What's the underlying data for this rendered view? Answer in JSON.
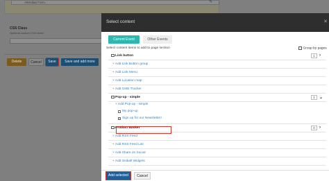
{
  "background": {
    "top_field_value": "Attendaa Form",
    "css_class_label": "CSS Class",
    "css_class_help": "Optional custom CSS class",
    "buttons": {
      "delete": "Delete",
      "cancel": "Cancel",
      "save": "Save",
      "save_and_add_more": "Save and add more"
    }
  },
  "modal": {
    "title": "Select content",
    "tabs": [
      {
        "label": "Current Event",
        "active": true
      },
      {
        "label": "Other Events",
        "active": false
      }
    ],
    "hint": "Select content items to add to page section",
    "group_by_label": "Group by pages",
    "items": [
      {
        "type": "header",
        "label": "Link button"
      },
      {
        "type": "item",
        "label": "+ Add Link Button group"
      },
      {
        "type": "item",
        "label": "+ Add Link Menu"
      },
      {
        "type": "item",
        "label": "+ Add Location map"
      },
      {
        "type": "item",
        "label": "+ Add OnBi Tracker"
      },
      {
        "type": "header",
        "label": "Pop-up - simple",
        "count": "2"
      },
      {
        "type": "sub",
        "label": "+ Add Pop-up - simple"
      },
      {
        "type": "check",
        "label": "My pop-up",
        "checked": false
      },
      {
        "type": "check",
        "label": "Sign up for our Newsletter!",
        "checked": true
      },
      {
        "type": "header",
        "label": "Product Basket",
        "count": "0"
      },
      {
        "type": "item",
        "label": "+ Add RSS Feed"
      },
      {
        "type": "item",
        "label": "+ Add RSS Feed List"
      },
      {
        "type": "item",
        "label": "+ Add Share on Social"
      },
      {
        "type": "item",
        "label": "+ Add Sniball Widgets"
      }
    ],
    "first_count": "1",
    "footer": {
      "add_selected": "Add selected",
      "cancel": "Cancel"
    }
  }
}
